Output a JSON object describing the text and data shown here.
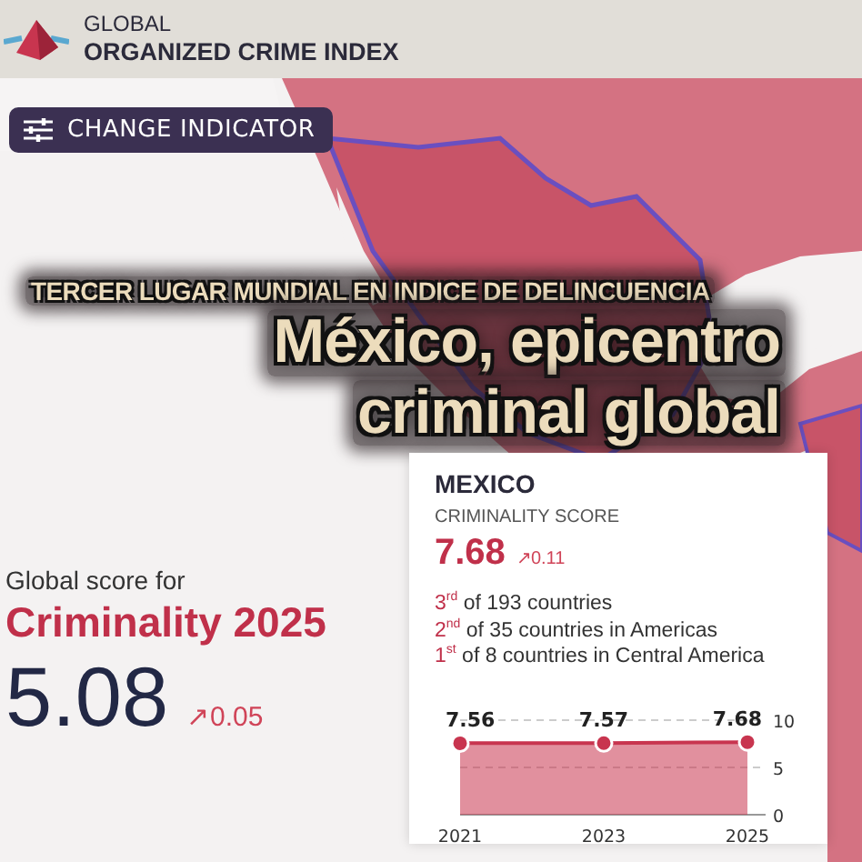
{
  "header": {
    "brand_top": "GLOBAL",
    "brand_name": "ORGANIZED CRIME INDEX"
  },
  "toolbar": {
    "button": "CHANGE INDICATOR"
  },
  "headline": {
    "kicker": "TERCER LUGAR MUNDIAL EN INDICE DE DELINCUENCIA",
    "title_lines": [
      "México, epicentro",
      "criminal global"
    ]
  },
  "global_score": {
    "label": "Global score for",
    "title": "Criminality 2025",
    "value": "5.08",
    "change": "↗0.05"
  },
  "country_card": {
    "country": "MEXICO",
    "metric": "CRIMINALITY SCORE",
    "score": "7.68",
    "change": "↗0.11",
    "ranks": [
      {
        "ordinal": "3",
        "suffix": "rd",
        "text": "of 193 countries"
      },
      {
        "ordinal": "2",
        "suffix": "nd",
        "text": "of 35 countries in Americas"
      },
      {
        "ordinal": "1",
        "suffix": "st",
        "text": "of 8 countries in Central America"
      }
    ],
    "chart_data": {
      "type": "area",
      "categories": [
        "2021",
        "2023",
        "2025"
      ],
      "series": [
        {
          "color": "#c8354f",
          "values": [
            7.56,
            7.57,
            7.68
          ]
        }
      ],
      "ylim": [
        0,
        10
      ],
      "yticks": [
        0,
        5,
        10
      ],
      "data_labels": true
    }
  }
}
